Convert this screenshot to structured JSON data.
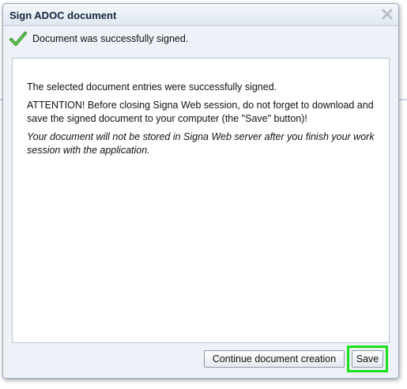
{
  "dialog": {
    "title": "Sign ADOC document",
    "close_icon": "close-x-icon",
    "status": {
      "icon": "checkmark-icon",
      "text": "Document was successfully signed."
    },
    "message": {
      "line1": "The selected document entries were successfully signed.",
      "attention": "ATTENTION! Before closing Signa Web session, do not forget to download and save the signed document to your computer (the \"Save\" button)!",
      "note": "Your document will not be stored in Signa Web server after you finish your work session with the application."
    },
    "buttons": {
      "continue_label": "Continue document creation",
      "save_label": "Save"
    }
  },
  "colors": {
    "highlight": "#18e01a",
    "check_green": "#3aa832",
    "title_text": "#15263c"
  }
}
